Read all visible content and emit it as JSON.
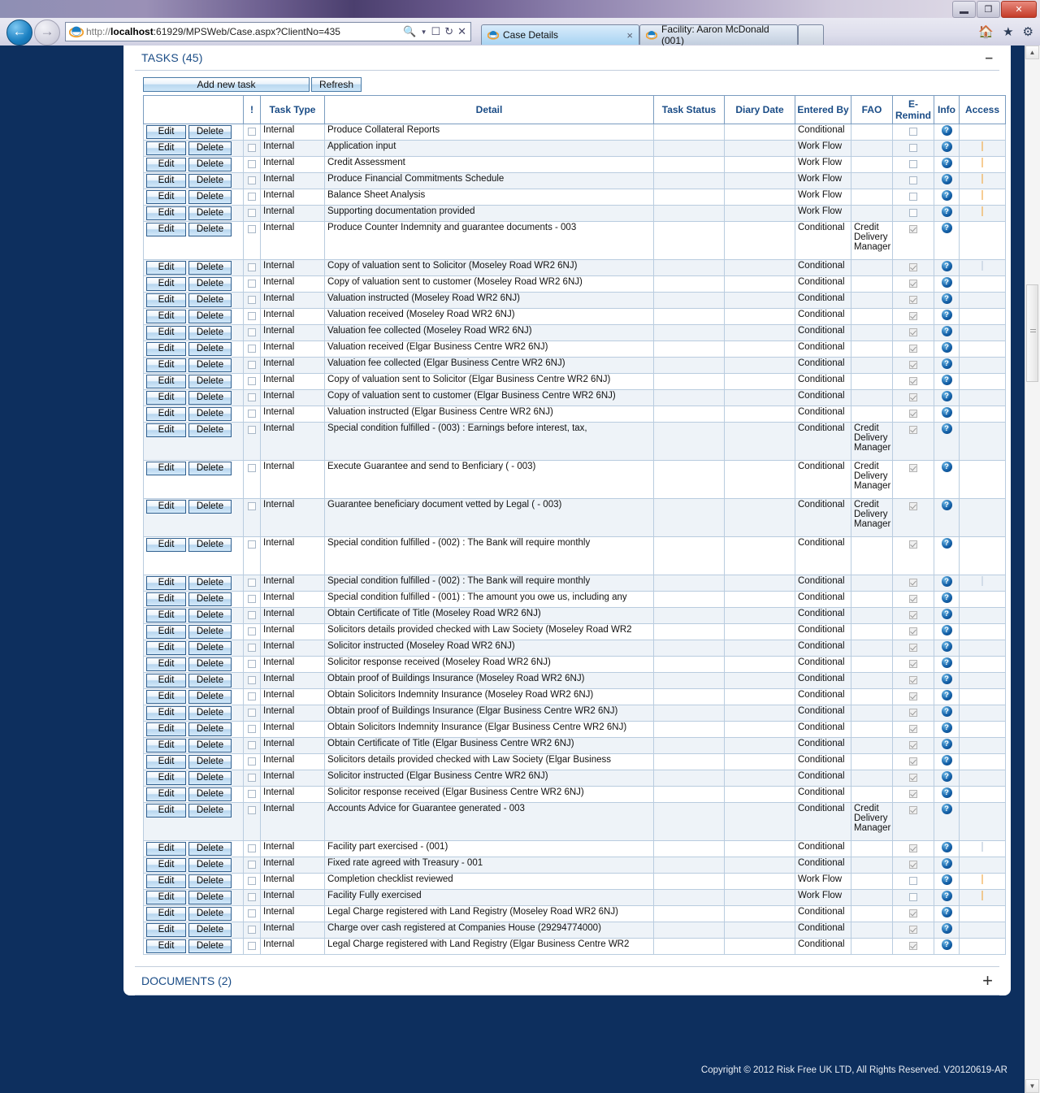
{
  "browser": {
    "url_protocol": "http://",
    "url_host": "localhost",
    "url_rest": ":61929/MPSWeb/Case.aspx?ClientNo=435",
    "search_icon": "search-icon",
    "compat_icon": "compatibility-view-icon",
    "refresh_icon": "refresh-icon",
    "stop_icon": "stop-icon",
    "home_icon": "home-icon",
    "favorites_icon": "favorites-star-icon",
    "tools_icon": "tools-gear-icon",
    "back_glyph": "←",
    "forward_glyph": "→",
    "tabs": [
      {
        "label": "Case Details",
        "active": true,
        "close_glyph": "×"
      },
      {
        "label": "Facility: Aaron McDonald (001)",
        "active": false,
        "close_glyph": ""
      }
    ],
    "new_tab_label": "",
    "window_controls": {
      "minimize": "",
      "restore": "❐",
      "close": "✕"
    }
  },
  "panel": {
    "title": "TASKS (45)",
    "collapse_glyph": "–",
    "toolbar": {
      "add_label": "Add new task",
      "refresh_label": "Refresh"
    },
    "columns": [
      {
        "key": "actions",
        "label": ""
      },
      {
        "key": "bang",
        "label": "!"
      },
      {
        "key": "type",
        "label": "Task Type"
      },
      {
        "key": "detail",
        "label": "Detail"
      },
      {
        "key": "status",
        "label": "Task Status"
      },
      {
        "key": "diary",
        "label": "Diary Date"
      },
      {
        "key": "entered",
        "label": "Entered By"
      },
      {
        "key": "fao",
        "label": "FAO"
      },
      {
        "key": "eremind",
        "label": "E-Remind"
      },
      {
        "key": "info",
        "label": "Info"
      },
      {
        "key": "access",
        "label": "Access"
      }
    ],
    "row_actions": {
      "edit_label": "Edit",
      "delete_label": "Delete"
    },
    "info_glyph": "?",
    "rows": [
      {
        "type": "Internal",
        "detail": "Produce Collateral Reports",
        "status": "",
        "diary": "",
        "entered": "Conditional",
        "fao": "",
        "eremind": false,
        "tall": false,
        "access": ""
      },
      {
        "type": "Internal",
        "detail": "Application input",
        "status": "",
        "diary": "",
        "entered": "Work Flow",
        "fao": "",
        "eremind": false,
        "tall": false,
        "access": "mark"
      },
      {
        "type": "Internal",
        "detail": "Credit Assessment",
        "status": "",
        "diary": "",
        "entered": "Work Flow",
        "fao": "",
        "eremind": false,
        "tall": false,
        "access": "mark"
      },
      {
        "type": "Internal",
        "detail": "Produce Financial Commitments Schedule",
        "status": "",
        "diary": "",
        "entered": "Work Flow",
        "fao": "",
        "eremind": false,
        "tall": false,
        "access": "mark"
      },
      {
        "type": "Internal",
        "detail": "Balance Sheet Analysis",
        "status": "",
        "diary": "",
        "entered": "Work Flow",
        "fao": "",
        "eremind": false,
        "tall": false,
        "access": "mark"
      },
      {
        "type": "Internal",
        "detail": "Supporting documentation provided",
        "status": "",
        "diary": "",
        "entered": "Work Flow",
        "fao": "",
        "eremind": false,
        "tall": false,
        "access": "mark"
      },
      {
        "type": "Internal",
        "detail": "Produce Counter Indemnity and guarantee documents - 003",
        "status": "",
        "diary": "",
        "entered": "Conditional",
        "fao": "Credit Delivery Manager",
        "eremind": true,
        "tall": true,
        "access": ""
      },
      {
        "type": "Internal",
        "detail": "Copy of valuation sent to Solicitor  (Moseley Road WR2 6NJ)",
        "status": "",
        "diary": "",
        "entered": "Conditional",
        "fao": "",
        "eremind": true,
        "tall": false,
        "access": "pale"
      },
      {
        "type": "Internal",
        "detail": "Copy of valuation sent to customer (Moseley Road WR2 6NJ)",
        "status": "",
        "diary": "",
        "entered": "Conditional",
        "fao": "",
        "eremind": true,
        "tall": false,
        "access": ""
      },
      {
        "type": "Internal",
        "detail": "Valuation instructed (Moseley Road WR2 6NJ)",
        "status": "",
        "diary": "",
        "entered": "Conditional",
        "fao": "",
        "eremind": true,
        "tall": false,
        "access": ""
      },
      {
        "type": "Internal",
        "detail": "Valuation received  (Moseley Road WR2 6NJ)",
        "status": "",
        "diary": "",
        "entered": "Conditional",
        "fao": "",
        "eremind": true,
        "tall": false,
        "access": ""
      },
      {
        "type": "Internal",
        "detail": "Valuation fee collected (Moseley Road WR2 6NJ)",
        "status": "",
        "diary": "",
        "entered": "Conditional",
        "fao": "",
        "eremind": true,
        "tall": false,
        "access": ""
      },
      {
        "type": "Internal",
        "detail": "Valuation received  (Elgar Business Centre WR2 6NJ)",
        "status": "",
        "diary": "",
        "entered": "Conditional",
        "fao": "",
        "eremind": true,
        "tall": false,
        "access": ""
      },
      {
        "type": "Internal",
        "detail": "Valuation fee collected (Elgar Business Centre WR2 6NJ)",
        "status": "",
        "diary": "",
        "entered": "Conditional",
        "fao": "",
        "eremind": true,
        "tall": false,
        "access": ""
      },
      {
        "type": "Internal",
        "detail": "Copy of valuation sent to Solicitor  (Elgar Business Centre WR2 6NJ)",
        "status": "",
        "diary": "",
        "entered": "Conditional",
        "fao": "",
        "eremind": true,
        "tall": false,
        "access": ""
      },
      {
        "type": "Internal",
        "detail": "Copy of valuation sent to customer (Elgar Business Centre WR2 6NJ)",
        "status": "",
        "diary": "",
        "entered": "Conditional",
        "fao": "",
        "eremind": true,
        "tall": false,
        "access": ""
      },
      {
        "type": "Internal",
        "detail": "Valuation instructed (Elgar Business Centre WR2 6NJ)",
        "status": "",
        "diary": "",
        "entered": "Conditional",
        "fao": "",
        "eremind": true,
        "tall": false,
        "access": ""
      },
      {
        "type": "Internal",
        "detail": "Special condition fulfilled - (003) : Earnings before interest, tax,",
        "status": "",
        "diary": "",
        "entered": "Conditional",
        "fao": "Credit Delivery Manager",
        "eremind": true,
        "tall": true,
        "access": ""
      },
      {
        "type": "Internal",
        "detail": "Execute Guarantee and send to Benficiary ( - 003)",
        "status": "",
        "diary": "",
        "entered": "Conditional",
        "fao": "Credit Delivery Manager",
        "eremind": true,
        "tall": true,
        "access": ""
      },
      {
        "type": "Internal",
        "detail": "Guarantee beneficiary document vetted by Legal ( - 003)",
        "status": "",
        "diary": "",
        "entered": "Conditional",
        "fao": "Credit Delivery Manager",
        "eremind": true,
        "tall": true,
        "access": ""
      },
      {
        "type": "Internal",
        "detail": "Special condition fulfilled - (002) : The Bank will require monthly",
        "status": "",
        "diary": "",
        "entered": "Conditional",
        "fao": "",
        "eremind": true,
        "tall": true,
        "access": "",
        "artifact": true
      },
      {
        "type": "Internal",
        "detail": "Special condition fulfilled - (002) : The Bank will require monthly",
        "status": "",
        "diary": "",
        "entered": "Conditional",
        "fao": "",
        "eremind": true,
        "tall": false,
        "access": "pale"
      },
      {
        "type": "Internal",
        "detail": "Special condition fulfilled - (001) : The amount you owe us, including any",
        "status": "",
        "diary": "",
        "entered": "Conditional",
        "fao": "",
        "eremind": true,
        "tall": false,
        "access": ""
      },
      {
        "type": "Internal",
        "detail": "Obtain Certificate of Title (Moseley Road WR2 6NJ)",
        "status": "",
        "diary": "",
        "entered": "Conditional",
        "fao": "",
        "eremind": true,
        "tall": false,
        "access": ""
      },
      {
        "type": "Internal",
        "detail": "Solicitors details provided checked with Law Society (Moseley Road WR2",
        "status": "",
        "diary": "",
        "entered": "Conditional",
        "fao": "",
        "eremind": true,
        "tall": false,
        "access": ""
      },
      {
        "type": "Internal",
        "detail": "Solicitor instructed (Moseley Road WR2 6NJ)",
        "status": "",
        "diary": "",
        "entered": "Conditional",
        "fao": "",
        "eremind": true,
        "tall": false,
        "access": ""
      },
      {
        "type": "Internal",
        "detail": "Solicitor response received (Moseley Road WR2 6NJ)",
        "status": "",
        "diary": "",
        "entered": "Conditional",
        "fao": "",
        "eremind": true,
        "tall": false,
        "access": ""
      },
      {
        "type": "Internal",
        "detail": "Obtain proof of Buildings Insurance (Moseley Road WR2 6NJ)",
        "status": "",
        "diary": "",
        "entered": "Conditional",
        "fao": "",
        "eremind": true,
        "tall": false,
        "access": ""
      },
      {
        "type": "Internal",
        "detail": "Obtain Solicitors Indemnity Insurance (Moseley Road WR2 6NJ)",
        "status": "",
        "diary": "",
        "entered": "Conditional",
        "fao": "",
        "eremind": true,
        "tall": false,
        "access": ""
      },
      {
        "type": "Internal",
        "detail": "Obtain proof of Buildings Insurance (Elgar Business Centre WR2 6NJ)",
        "status": "",
        "diary": "",
        "entered": "Conditional",
        "fao": "",
        "eremind": true,
        "tall": false,
        "access": ""
      },
      {
        "type": "Internal",
        "detail": "Obtain Solicitors Indemnity Insurance (Elgar Business Centre WR2 6NJ)",
        "status": "",
        "diary": "",
        "entered": "Conditional",
        "fao": "",
        "eremind": true,
        "tall": false,
        "access": ""
      },
      {
        "type": "Internal",
        "detail": "Obtain Certificate of Title (Elgar Business Centre WR2 6NJ)",
        "status": "",
        "diary": "",
        "entered": "Conditional",
        "fao": "",
        "eremind": true,
        "tall": false,
        "access": ""
      },
      {
        "type": "Internal",
        "detail": "Solicitors details provided checked with Law Society (Elgar Business",
        "status": "",
        "diary": "",
        "entered": "Conditional",
        "fao": "",
        "eremind": true,
        "tall": false,
        "access": ""
      },
      {
        "type": "Internal",
        "detail": "Solicitor instructed (Elgar Business Centre WR2 6NJ)",
        "status": "",
        "diary": "",
        "entered": "Conditional",
        "fao": "",
        "eremind": true,
        "tall": false,
        "access": ""
      },
      {
        "type": "Internal",
        "detail": "Solicitor response received (Elgar Business Centre WR2 6NJ)",
        "status": "",
        "diary": "",
        "entered": "Conditional",
        "fao": "",
        "eremind": true,
        "tall": false,
        "access": ""
      },
      {
        "type": "Internal",
        "detail": "Accounts Advice for Guarantee generated - 003",
        "status": "",
        "diary": "",
        "entered": "Conditional",
        "fao": "Credit Delivery Manager",
        "eremind": true,
        "tall": true,
        "access": ""
      },
      {
        "type": "Internal",
        "detail": "Facility part exercised - (001)",
        "status": "",
        "diary": "",
        "entered": "Conditional",
        "fao": "",
        "eremind": true,
        "tall": false,
        "access": "pale"
      },
      {
        "type": "Internal",
        "detail": "Fixed rate agreed with Treasury - 001",
        "status": "",
        "diary": "",
        "entered": "Conditional",
        "fao": "",
        "eremind": true,
        "tall": false,
        "access": ""
      },
      {
        "type": "Internal",
        "detail": "Completion checklist reviewed",
        "status": "",
        "diary": "",
        "entered": "Work Flow",
        "fao": "",
        "eremind": false,
        "tall": false,
        "access": "mark"
      },
      {
        "type": "Internal",
        "detail": "Facility Fully exercised",
        "status": "",
        "diary": "",
        "entered": "Work Flow",
        "fao": "",
        "eremind": false,
        "tall": false,
        "access": "mark"
      },
      {
        "type": "Internal",
        "detail": "Legal Charge registered with Land Registry (Moseley Road WR2 6NJ)",
        "status": "",
        "diary": "",
        "entered": "Conditional",
        "fao": "",
        "eremind": true,
        "tall": false,
        "access": ""
      },
      {
        "type": "Internal",
        "detail": "Charge over cash registered at Companies House (29294774000)",
        "status": "",
        "diary": "",
        "entered": "Conditional",
        "fao": "",
        "eremind": true,
        "tall": false,
        "access": ""
      },
      {
        "type": "Internal",
        "detail": "Legal Charge registered with Land Registry (Elgar Business Centre WR2",
        "status": "",
        "diary": "",
        "entered": "Conditional",
        "fao": "",
        "eremind": true,
        "tall": false,
        "access": ""
      }
    ]
  },
  "documents_panel": {
    "title": "DOCUMENTS (2)",
    "expand_glyph": "+"
  },
  "footer": {
    "copyright": "Copyright © 2012 Risk Free UK LTD, All Rights Reserved. V20120619-AR"
  },
  "scrollbar": {
    "up_glyph": "▲",
    "down_glyph": "▼"
  },
  "colors": {
    "app_background": "#0d2f5e",
    "panel_title": "#1a4c86",
    "card": "#ffffff",
    "row_alt": "#eef3f8",
    "grid_line": "#b9ccdf",
    "header_border": "#7a9cc0",
    "access_mark": "#f0a43c"
  }
}
